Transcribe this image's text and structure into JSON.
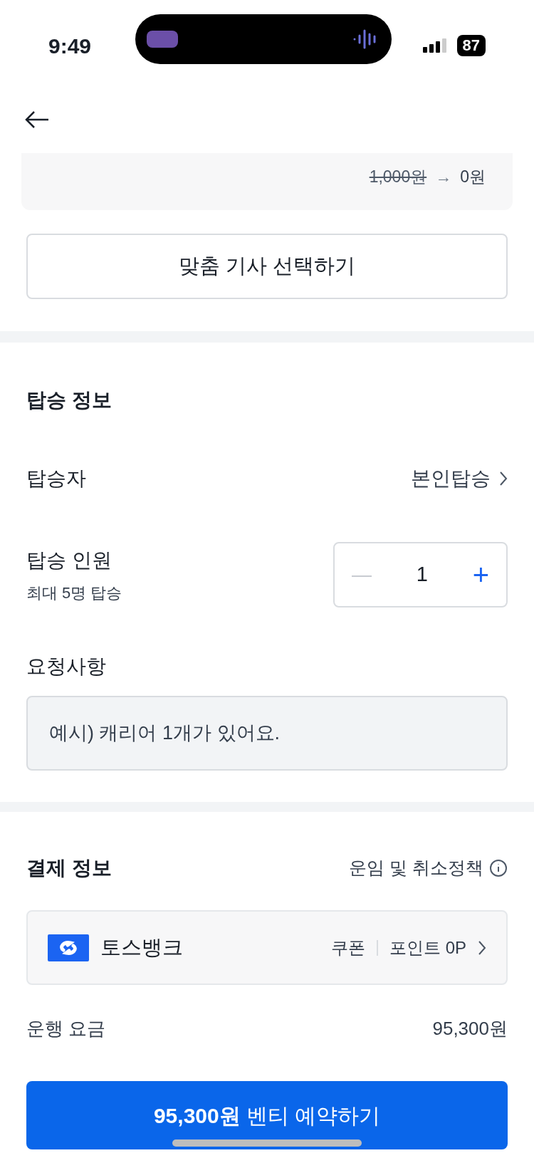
{
  "status_bar": {
    "time": "9:49",
    "battery": "87"
  },
  "fee_card": {
    "old_price": "1,000원",
    "arrow": "→",
    "new_price": "0원"
  },
  "driver_button": "맞춤 기사 선택하기",
  "ride_info": {
    "title": "탑승 정보",
    "passenger": {
      "label": "탑승자",
      "value": "본인탑승"
    },
    "count": {
      "label": "탑승 인원",
      "hint": "최대 5명 탑승",
      "value": "1",
      "minus_disabled": true,
      "minus": "—",
      "plus": "+"
    },
    "request": {
      "label": "요청사항",
      "placeholder": "예시) 캐리어 1개가 있어요."
    }
  },
  "payment": {
    "title": "결제 정보",
    "policy_link": "운임 및 취소정책",
    "method": {
      "name": "토스뱅크",
      "coupon": "쿠폰",
      "points": "포인트 0P"
    },
    "fare": {
      "label": "운행 요금",
      "value": "95,300원"
    }
  },
  "cta": {
    "amount": "95,300원",
    "label": "벤티 예약하기"
  }
}
